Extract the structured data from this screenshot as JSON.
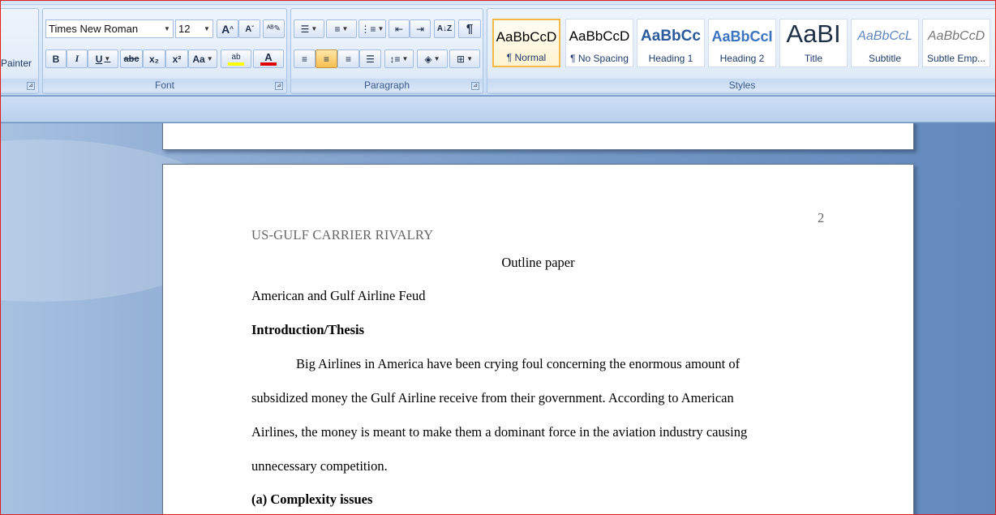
{
  "ribbon": {
    "clipboard": {
      "painter_label": "Painter"
    },
    "font": {
      "group_label": "Font",
      "font_name": "Times New Roman",
      "font_size": "12",
      "grow_font": "A",
      "shrink_font": "A",
      "bold": "B",
      "italic": "I",
      "underline": "U",
      "strikethrough": "abc",
      "subscript": "x₂",
      "superscript": "x²",
      "change_case": "Aa",
      "highlight": "ab",
      "font_color": "A"
    },
    "paragraph": {
      "group_label": "Paragraph",
      "show_marks": "¶"
    },
    "styles": {
      "group_label": "Styles",
      "items": [
        {
          "sample": "AaBbCcD",
          "name": "¶ Normal"
        },
        {
          "sample": "AaBbCcD",
          "name": "¶ No Spacing"
        },
        {
          "sample": "AaBbCc",
          "name": "Heading 1"
        },
        {
          "sample": "AaBbCcI",
          "name": "Heading 2"
        },
        {
          "sample": "AaBI",
          "name": "Title"
        },
        {
          "sample": "AaBbCcL",
          "name": "Subtitle"
        },
        {
          "sample": "AaBbCcD",
          "name": "Subtle Emp..."
        }
      ]
    }
  },
  "colors": {
    "highlight": "#ffff00",
    "font_color": "#e00000",
    "selection": "#f1b94a"
  },
  "document": {
    "page_number": "2",
    "running_head": "US-GULF CARRIER RIVALRY",
    "title": "Outline paper",
    "lines": [
      "American and Gulf Airline Feud",
      "Introduction/Thesis",
      "Big Airlines in America have been crying foul concerning the enormous amount of",
      "subsidized money the Gulf Airline receive from their government. According to American",
      "Airlines, the money is meant to make them a dominant force in the aviation industry causing",
      "unnecessary competition.",
      "(a) Complexity issues"
    ]
  }
}
